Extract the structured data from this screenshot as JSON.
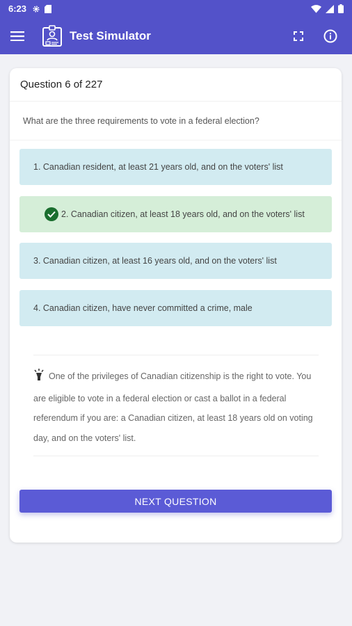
{
  "status_bar": {
    "time": "6:23",
    "left_icons": [
      "gear-icon",
      "sd-card-icon"
    ],
    "right_icons": [
      "wifi-icon",
      "signal-icon",
      "battery-icon"
    ]
  },
  "app_bar": {
    "title": "Test Simulator",
    "icons": [
      "menu-icon",
      "id-card-logo-icon",
      "fullscreen-icon",
      "info-icon"
    ],
    "background_color": "#5352c9"
  },
  "question": {
    "counter": "Question 6 of 227",
    "text": "What are the three requirements to vote in a federal election?"
  },
  "answers": [
    {
      "label": "1. Canadian resident, at least 21 years old, and on the voters' list",
      "state": "normal"
    },
    {
      "label": "2. Canadian citizen, at least 18 years old, and on the voters' list",
      "state": "correct"
    },
    {
      "label": "3. Canadian citizen, at least 16 years old, and on the voters' list",
      "state": "normal"
    },
    {
      "label": "4. Canadian citizen, have never committed a crime, male",
      "state": "normal"
    }
  ],
  "explanation": {
    "icon": "lightbulb-icon",
    "text": "One of the privileges of Canadian citizenship is the right to vote. You are eligible to vote in a federal election or cast a ballot in a federal referendum if you are: a Canadian citizen, at least 18 years old on voting day, and on the voters' list."
  },
  "next_button": {
    "label": "NEXT QUESTION",
    "color": "#5b5bd6"
  },
  "colors": {
    "answer_normal": "#d2ebf1",
    "answer_correct": "#d5eed8",
    "check": "#1a6e2f"
  }
}
